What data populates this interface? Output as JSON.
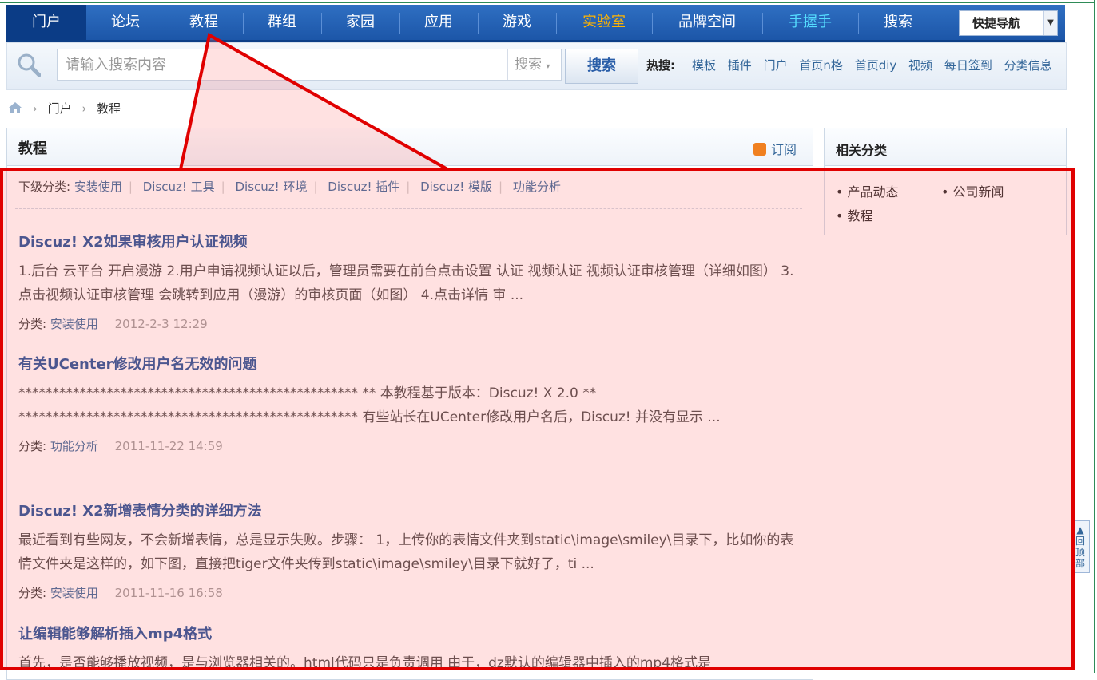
{
  "nav": {
    "items": [
      "门户",
      "论坛",
      "教程",
      "群组",
      "家园",
      "应用",
      "游戏",
      "实验室",
      "品牌空间",
      "手握手",
      "搜索"
    ],
    "quick_nav": "快捷导航",
    "colors": {
      "active_bg": "#0b3c86",
      "lab": "#ffb400",
      "hand": "#55ddff"
    }
  },
  "search": {
    "placeholder": "请输入搜索内容",
    "type": "搜索",
    "button": "搜索",
    "hot_label": "热搜:",
    "hot_links": [
      "模板",
      "插件",
      "门户",
      "首页n格",
      "首页diy",
      "视频",
      "每日签到",
      "分类信息"
    ]
  },
  "breadcrumb": {
    "items": [
      "门户",
      "教程"
    ]
  },
  "main": {
    "title": "教程",
    "subscribe": "订阅",
    "subcat_label": "下级分类:",
    "subcats": [
      "安装使用",
      "Discuz! 工具",
      "Discuz! 环境",
      "Discuz! 插件",
      "Discuz! 模版",
      "功能分析"
    ],
    "category_label": "分类:",
    "articles": [
      {
        "title": "Discuz! X2如果审核用户认证视频",
        "summary": "1.后台 云平台 开启漫游 2.用户申请视频认证以后，管理员需要在前台点击设置 认证 视频认证 视频认证审核管理（详细如图） 3.点击视频认证审核管理 会跳转到应用（漫游）的审核页面（如图） 4.点击详情 审 ...",
        "category": "安装使用",
        "date": "2012-2-3 12:29"
      },
      {
        "title": "有关UCenter修改用户名无效的问题",
        "summary": "************************************************** ** 本教程基于版本：Discuz! X 2.0 ** ************************************************** 有些站长在UCenter修改用户名后，Discuz! 并没有显示 ...",
        "category": "功能分析",
        "date": "2011-11-22 14:59"
      },
      {
        "title": "Discuz! X2新增表情分类的详细方法",
        "summary": "最近看到有些网友，不会新增表情，总是显示失败。步骤： 1，上传你的表情文件夹到static\\image\\smiley\\目录下，比如你的表情文件夹是这样的，如下图，直接把tiger文件夹传到static\\image\\smiley\\目录下就好了，ti ...",
        "category": "安装使用",
        "date": "2011-11-16 16:58"
      },
      {
        "title": "让编辑能够解析插入mp4格式",
        "summary": "首先，是否能够播放视频，是与浏览器相关的。html代码只是负责调用 由于，dz默认的编辑器中插入的mp4格式是",
        "category": "",
        "date": ""
      }
    ]
  },
  "side": {
    "title": "相关分类",
    "items": [
      "产品动态",
      "公司新闻",
      "教程"
    ]
  },
  "backtop": "回顶部",
  "annotation": {
    "color": "#e00000",
    "fill": "rgba(255,120,120,0.22)"
  }
}
